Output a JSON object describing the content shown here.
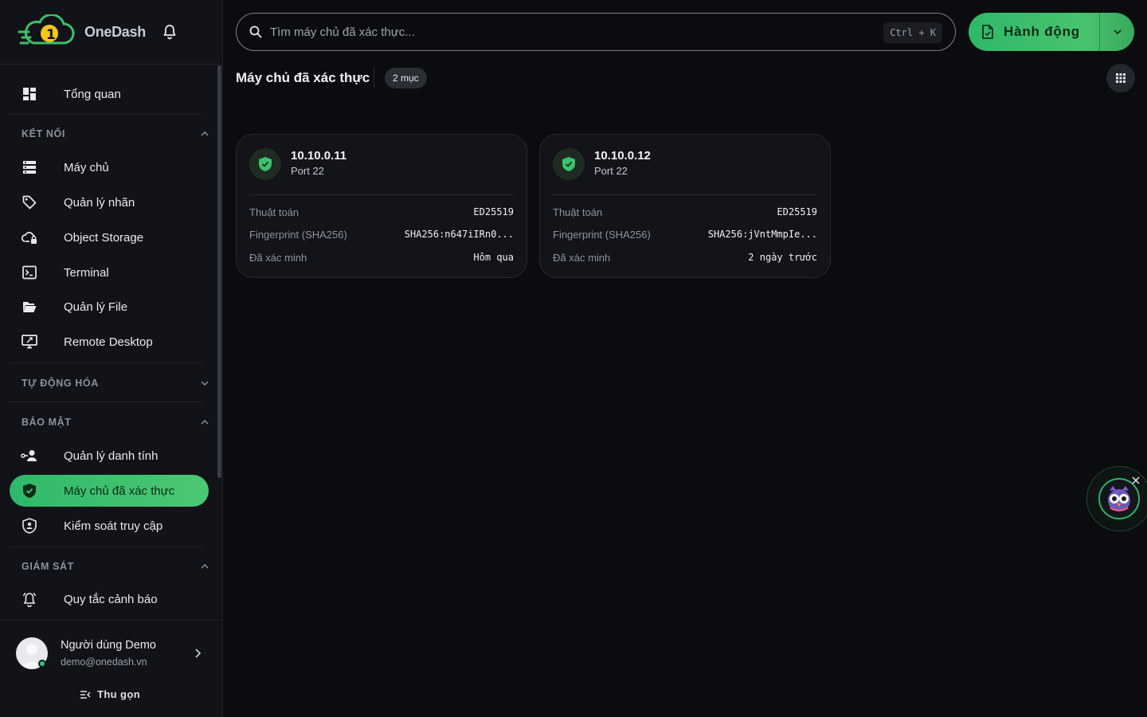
{
  "brand": {
    "name": "OneDash"
  },
  "nav": {
    "overview": "Tổng quan",
    "sections": {
      "connect": "KẾT NỐI",
      "automation": "TỰ ĐỘNG HÓA",
      "security": "BẢO MẬT",
      "monitoring": "GIÁM SÁT"
    },
    "items": {
      "servers": "Máy chủ",
      "tags": "Quản lý nhãn",
      "object_storage": "Object Storage",
      "terminal": "Terminal",
      "file_manager": "Quản lý File",
      "remote_desktop": "Remote Desktop",
      "identity": "Quản lý danh tính",
      "trusted_hosts": "Máy chủ đã xác thực",
      "access_control": "Kiểm soát truy cập",
      "alert_rules": "Quy tắc cảnh báo"
    }
  },
  "user": {
    "name": "Người dùng Demo",
    "email": "demo@onedash.vn",
    "collapse_label": "Thu gọn"
  },
  "search": {
    "placeholder": "Tìm máy chủ đã xác thực...",
    "shortcut": "Ctrl + K"
  },
  "action": {
    "label": "Hành động"
  },
  "page": {
    "title": "Máy chủ đã xác thực",
    "count": "2 mục"
  },
  "cards": [
    {
      "host": "10.10.0.11",
      "port": "Port 22",
      "algo_label": "Thuật toán",
      "algo": "ED25519",
      "fp_label": "Fingerprint (SHA256)",
      "fp": "SHA256:n647iIRn0...",
      "verified_label": "Đã xác minh",
      "verified": "Hôm qua"
    },
    {
      "host": "10.10.0.12",
      "port": "Port 22",
      "algo_label": "Thuật toán",
      "algo": "ED25519",
      "fp_label": "Fingerprint (SHA256)",
      "fp": "SHA256:jVntMmpIe...",
      "verified_label": "Đã xác minh",
      "verified": "2 ngày trước"
    }
  ],
  "colors": {
    "accent": "#2fb86a",
    "accent_light": "#4cc872",
    "background": "#0b0c0f",
    "sidebar": "#111318",
    "card": "#121419"
  },
  "icons": {
    "logo": "cloud-1-logo-icon",
    "bell": "bell-icon",
    "search": "search-icon",
    "action": "file-action-icon",
    "dropdown": "chevron-down-icon",
    "grid": "grid-view-icon",
    "shield": "shield-check-icon",
    "assistant": "owl-assistant-icon"
  }
}
